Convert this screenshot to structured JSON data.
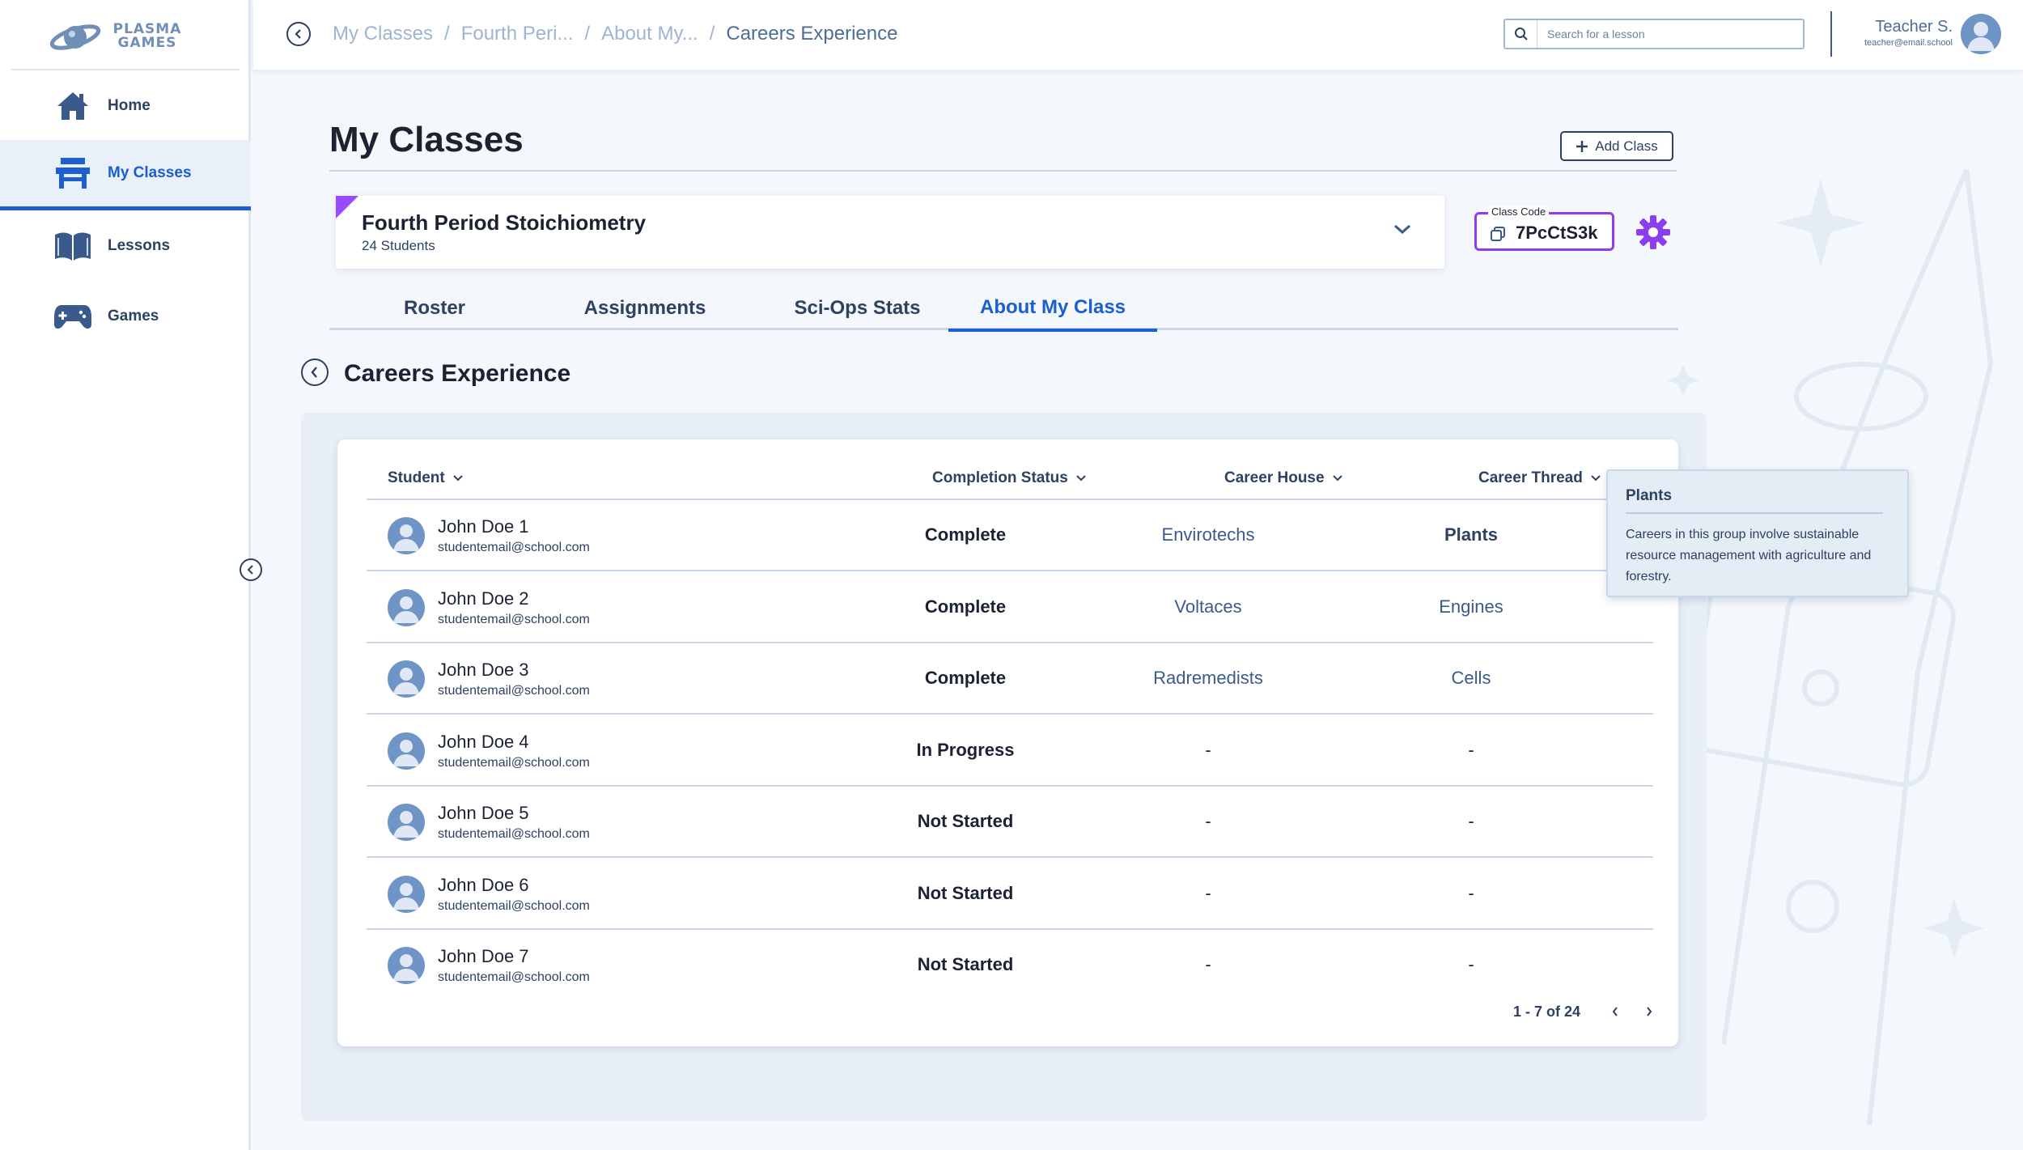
{
  "brand": {
    "logo_line1": "PLASMA",
    "logo_line2": "GAMES"
  },
  "sidebar": {
    "items": [
      {
        "label": "Home",
        "icon": "home-icon"
      },
      {
        "label": "My Classes",
        "icon": "classroom-desk-icon",
        "active": true
      },
      {
        "label": "Lessons",
        "icon": "open-book-icon"
      },
      {
        "label": "Games",
        "icon": "gamepad-icon"
      }
    ]
  },
  "topbar": {
    "breadcrumbs": [
      "My Classes",
      "Fourth Peri...",
      "About My...",
      "Careers Experience"
    ],
    "search_placeholder": "Search for a lesson",
    "user_name": "Teacher S.",
    "user_email": "teacher@email.school"
  },
  "main": {
    "title": "My Classes",
    "add_class_label": "Add Class",
    "class": {
      "name": "Fourth Period Stoichiometry",
      "student_count": "24 Students",
      "code_label": "Class Code",
      "code": "7PcCtS3k"
    },
    "tabs": [
      {
        "label": "Roster"
      },
      {
        "label": "Assignments"
      },
      {
        "label": "Sci-Ops Stats"
      },
      {
        "label": "About My Class",
        "active": true
      }
    ],
    "section_title": "Careers Experience",
    "table": {
      "headers": [
        "Student",
        "Completion Status",
        "Career House",
        "Career Thread"
      ],
      "rows": [
        {
          "name": "John Doe 1",
          "email": "studentemail@school.com",
          "status": "Complete",
          "house": "Envirotechs",
          "thread": "Plants"
        },
        {
          "name": "John Doe 2",
          "email": "studentemail@school.com",
          "status": "Complete",
          "house": "Voltaces",
          "thread": "Engines"
        },
        {
          "name": "John Doe 3",
          "email": "studentemail@school.com",
          "status": "Complete",
          "house": "Radremedists",
          "thread": "Cells"
        },
        {
          "name": "John Doe 4",
          "email": "studentemail@school.com",
          "status": "In Progress",
          "house": "-",
          "thread": "-"
        },
        {
          "name": "John Doe 5",
          "email": "studentemail@school.com",
          "status": "Not Started",
          "house": "-",
          "thread": "-"
        },
        {
          "name": "John Doe 6",
          "email": "studentemail@school.com",
          "status": "Not Started",
          "house": "-",
          "thread": "-"
        },
        {
          "name": "John Doe 7",
          "email": "studentemail@school.com",
          "status": "Not Started",
          "house": "-",
          "thread": "-"
        }
      ],
      "pagination": "1 - 7 of 24"
    },
    "tooltip": {
      "title": "Plants",
      "body": "Careers in this group involve sustainable resource management with agriculture and forestry."
    }
  },
  "colors": {
    "accent": "#1a5ed0",
    "navy": "#2e4160",
    "class_code_border": "#8c3df0",
    "class_corner": "#9b4bff",
    "gear": "#8c3df0",
    "avatar": "#6f95c7"
  }
}
